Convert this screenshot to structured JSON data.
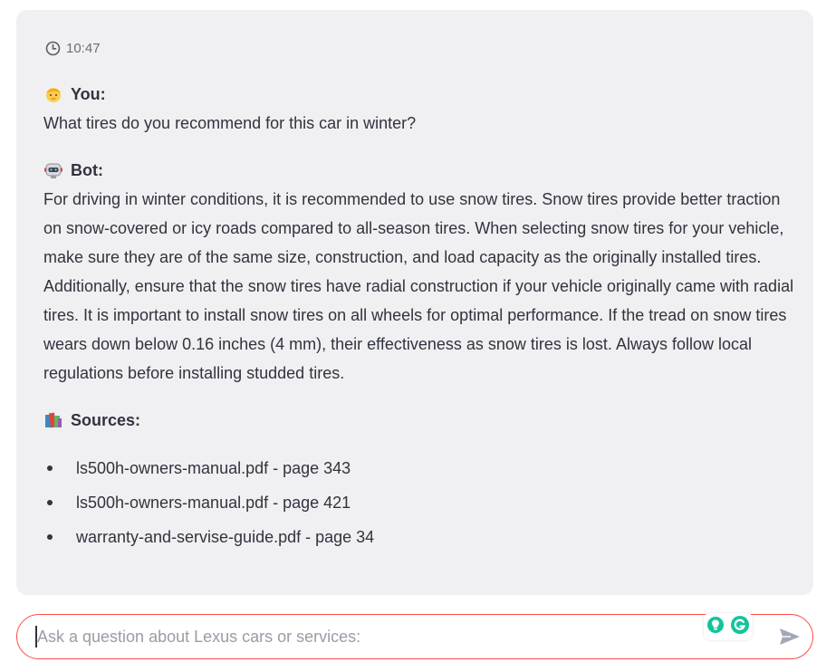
{
  "chat": {
    "timestamp": "10:47",
    "user_label": "You:",
    "user_message": "What tires do you recommend for this car in winter?",
    "bot_label": "Bot:",
    "bot_message": "For driving in winter conditions, it is recommended to use snow tires. Snow tires provide better traction on snow-covered or icy roads compared to all-season tires. When selecting snow tires for your vehicle, make sure they are of the same size, construction, and load capacity as the originally installed tires. Additionally, ensure that the snow tires have radial construction if your vehicle originally came with radial tires. It is important to install snow tires on all wheels for optimal performance. If the tread on snow tires wears down below 0.16 inches (4 mm), their effectiveness as snow tires is lost. Always follow local regulations before installing studded tires.",
    "sources_label": "Sources:",
    "sources": [
      "ls500h-owners-manual.pdf - page 343",
      "ls500h-owners-manual.pdf - page 421",
      "warranty-and-servise-guide.pdf - page 34"
    ]
  },
  "input": {
    "placeholder": "Ask a question about Lexus cars or services:",
    "value": ""
  },
  "icons": {
    "timestamp": "clock-icon",
    "user_avatar": "person-emoji-icon",
    "bot_avatar": "robot-emoji-icon",
    "sources": "books-emoji-icon",
    "extension_1": "lightbulb-extension-icon",
    "extension_2": "grammarly-icon",
    "send": "send-icon"
  },
  "colors": {
    "card_background": "#f0f0f2",
    "input_border_focus": "#ff4b4b",
    "text": "#31333f",
    "send_icon": "#a3a8b8",
    "grammarly_green": "#15c39a"
  }
}
